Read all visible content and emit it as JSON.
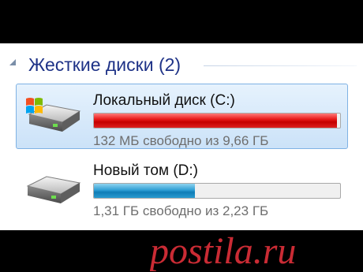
{
  "group": {
    "title": "Жесткие диски (2)"
  },
  "drives": [
    {
      "name": "Локальный диск (C:)",
      "free_text": "132 МБ свободно из 9,66 ГБ",
      "used_fraction": 0.987,
      "bar_color": "#d40000",
      "selected": true,
      "icon": "windows-hard-drive-icon"
    },
    {
      "name": "Новый том (D:)",
      "free_text": "1,31 ГБ свободно из 2,23 ГБ",
      "used_fraction": 0.41,
      "bar_color": "#1e8cc8",
      "selected": false,
      "icon": "hard-drive-icon"
    }
  ],
  "watermark": {
    "text": "postila.ru",
    "color": "#e0303a"
  }
}
